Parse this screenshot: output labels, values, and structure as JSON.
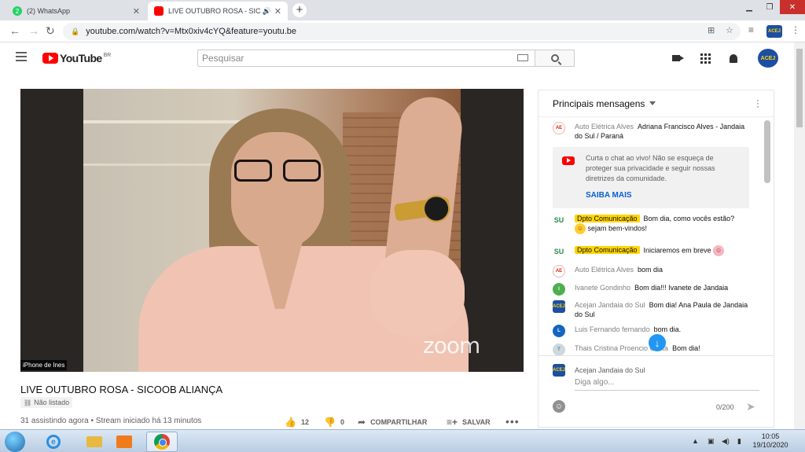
{
  "browser": {
    "tabs": [
      {
        "title": "(2) WhatsApp",
        "badge": "2",
        "active": false
      },
      {
        "title": "LIVE OUTUBRO ROSA - SICO",
        "active": true
      }
    ],
    "url": "youtube.com/watch?v=Mtx0xiv4cYQ&feature=youtu.be"
  },
  "youtube": {
    "logo_text": "YouTube",
    "country": "BR",
    "search_placeholder": "Pesquisar",
    "account_badge": "ACEJ"
  },
  "video": {
    "participant_name": "iPhone de Ines",
    "watermark": "zoom",
    "title": "LIVE OUTUBRO ROSA - SICOOB ALIANÇA",
    "privacy": "Não listado",
    "meta": "31 assistindo agora • Stream iniciado há 13 minutos",
    "likes": "12",
    "dislikes": "0",
    "share_label": "COMPARTILHAR",
    "save_label": "SALVAR"
  },
  "chat": {
    "header": "Principais mensagens",
    "notice": {
      "text": "Curta o chat ao vivo! Não se esqueça de proteger sua privacidade e seguir nossas diretrizes da comunidade.",
      "cta": "SAIBA MAIS"
    },
    "messages": [
      {
        "author": "Auto Elétrica Alves",
        "text": "Adriana Francisco Alves - Jandaia do Sul / Paraná"
      },
      {
        "author": "Dpto Comunicação",
        "text": "Bom dia, como vocês estão?",
        "text2": "sejam bem-vindos!"
      },
      {
        "author": "Dpto Comunicação",
        "text": "Iniciaremos em breve"
      },
      {
        "author": "Auto Elétrica Alves",
        "text": "bom dia"
      },
      {
        "author": "Ivanete Gondinho",
        "text": "Bom dia!!! Ivanete de Jandaia"
      },
      {
        "author": "Acejan Jandaia do Sul",
        "text": "Bom dia! Ana Paula de Jandaia do Sul"
      },
      {
        "author": "Luis Fernando fernando",
        "text": "bom dia."
      },
      {
        "author": "Thais Cristina Proencio Costa",
        "text": "Bom dia!"
      }
    ],
    "composer": {
      "author": "Acejan Jandaia do Sul",
      "placeholder": "Diga algo...",
      "count": "0/200"
    }
  },
  "taskbar": {
    "time": "10:05",
    "date": "19/10/2020"
  }
}
